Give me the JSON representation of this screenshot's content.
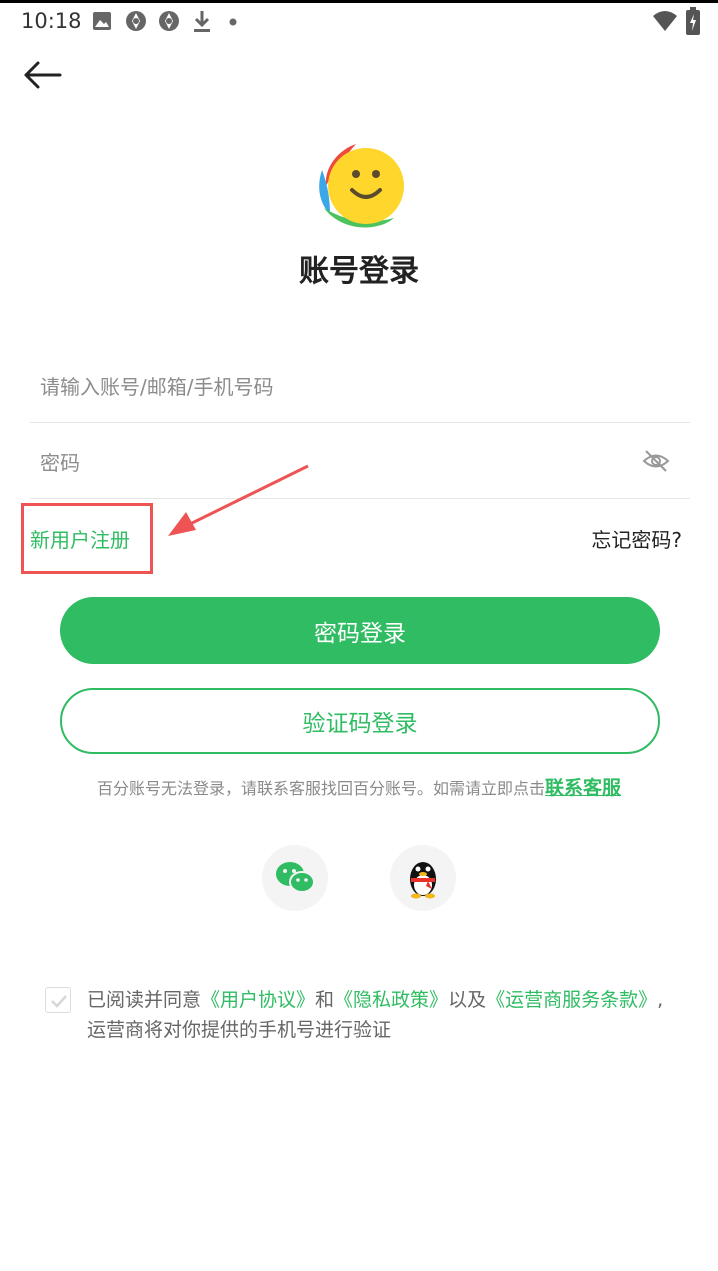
{
  "status_bar": {
    "time": "10:18",
    "left_icons": [
      "image-icon",
      "aperture-icon",
      "aperture-icon",
      "download-icon",
      "dot-icon"
    ],
    "right_icons": [
      "wifi-icon",
      "battery-icon"
    ]
  },
  "header": {
    "back_icon": "arrow-left-icon",
    "title": "账号登录"
  },
  "form": {
    "account_placeholder": "请输入账号/邮箱/手机号码",
    "account_value": "",
    "password_placeholder": "密码",
    "password_value": "",
    "eye_icon": "eye-off-icon",
    "register_label": "新用户注册",
    "forgot_label": "忘记密码?"
  },
  "buttons": {
    "password_login": "密码登录",
    "code_login": "验证码登录"
  },
  "notice": {
    "text": "百分账号无法登录，请联系客服找回百分账号。如需请立即点击",
    "link": "联系客服"
  },
  "social": {
    "wechat_icon": "wechat-icon",
    "qq_icon": "qq-icon"
  },
  "agreement": {
    "prefix": "已阅读并同意",
    "user_agreement": "《用户协议》",
    "and": "和",
    "privacy_policy": "《隐私政策》",
    "and_also": "以及",
    "carrier_terms": "《运营商服务条款》",
    "suffix": ",运营商将对你提供的手机号进行验证"
  },
  "colors": {
    "brand_green": "#2fbc62",
    "highlight_red": "#ee5454",
    "text_dark": "#222222",
    "text_gray": "#8a8a8a"
  }
}
